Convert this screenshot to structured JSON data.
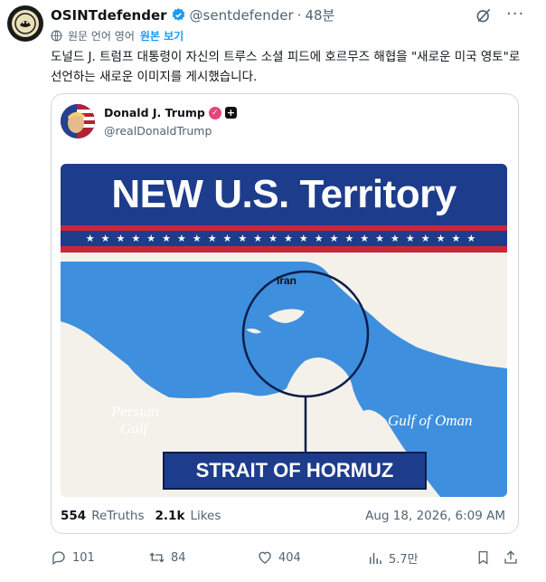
{
  "author": {
    "name": "OSINTdefender",
    "handle": "@sentdefender",
    "separator": "·",
    "time": "48분"
  },
  "translation": {
    "note": "원문 언어 영어",
    "show_original": "원본 보기"
  },
  "post_text": "도널드 J. 트럼프 대통령이 자신의 트루스 소셜 피드에 호르무즈 해협을 \"새로운 미국 영토\"로 선언하는 새로운 이미지를 게시했습니다.",
  "quoted": {
    "name": "Donald J. Trump",
    "handle": "@realDonaldTrump",
    "graphic": {
      "banner_title": "NEW U.S. Territory",
      "stars": "★★★★★★★★★★★★★★★★★★★★★★★★★★",
      "label_iran": "Iran",
      "label_persian_gulf_1": "Persian",
      "label_persian_gulf_2": "Gulf",
      "label_gulf_of_oman": "Gulf of Oman",
      "label_strait": "STRAIT OF HORMUZ",
      "colors": {
        "navy": "#1d3c8c",
        "red": "#c9283a",
        "water": "#3e8fde",
        "land": "#f4f1ea"
      }
    },
    "stats": {
      "retruths_count": "554",
      "retruths_label": "ReTruths",
      "likes_count": "2.1k",
      "likes_label": "Likes"
    },
    "date": "Aug 18, 2026, 6:09 AM"
  },
  "actions": {
    "replies": "101",
    "reposts": "84",
    "likes": "404",
    "views": "5.7만"
  },
  "icons": [
    "verified-badge-icon",
    "grok-icon",
    "more-icon",
    "translate-icon",
    "reply-icon",
    "repost-icon",
    "like-icon",
    "views-icon",
    "bookmark-icon",
    "share-icon"
  ]
}
